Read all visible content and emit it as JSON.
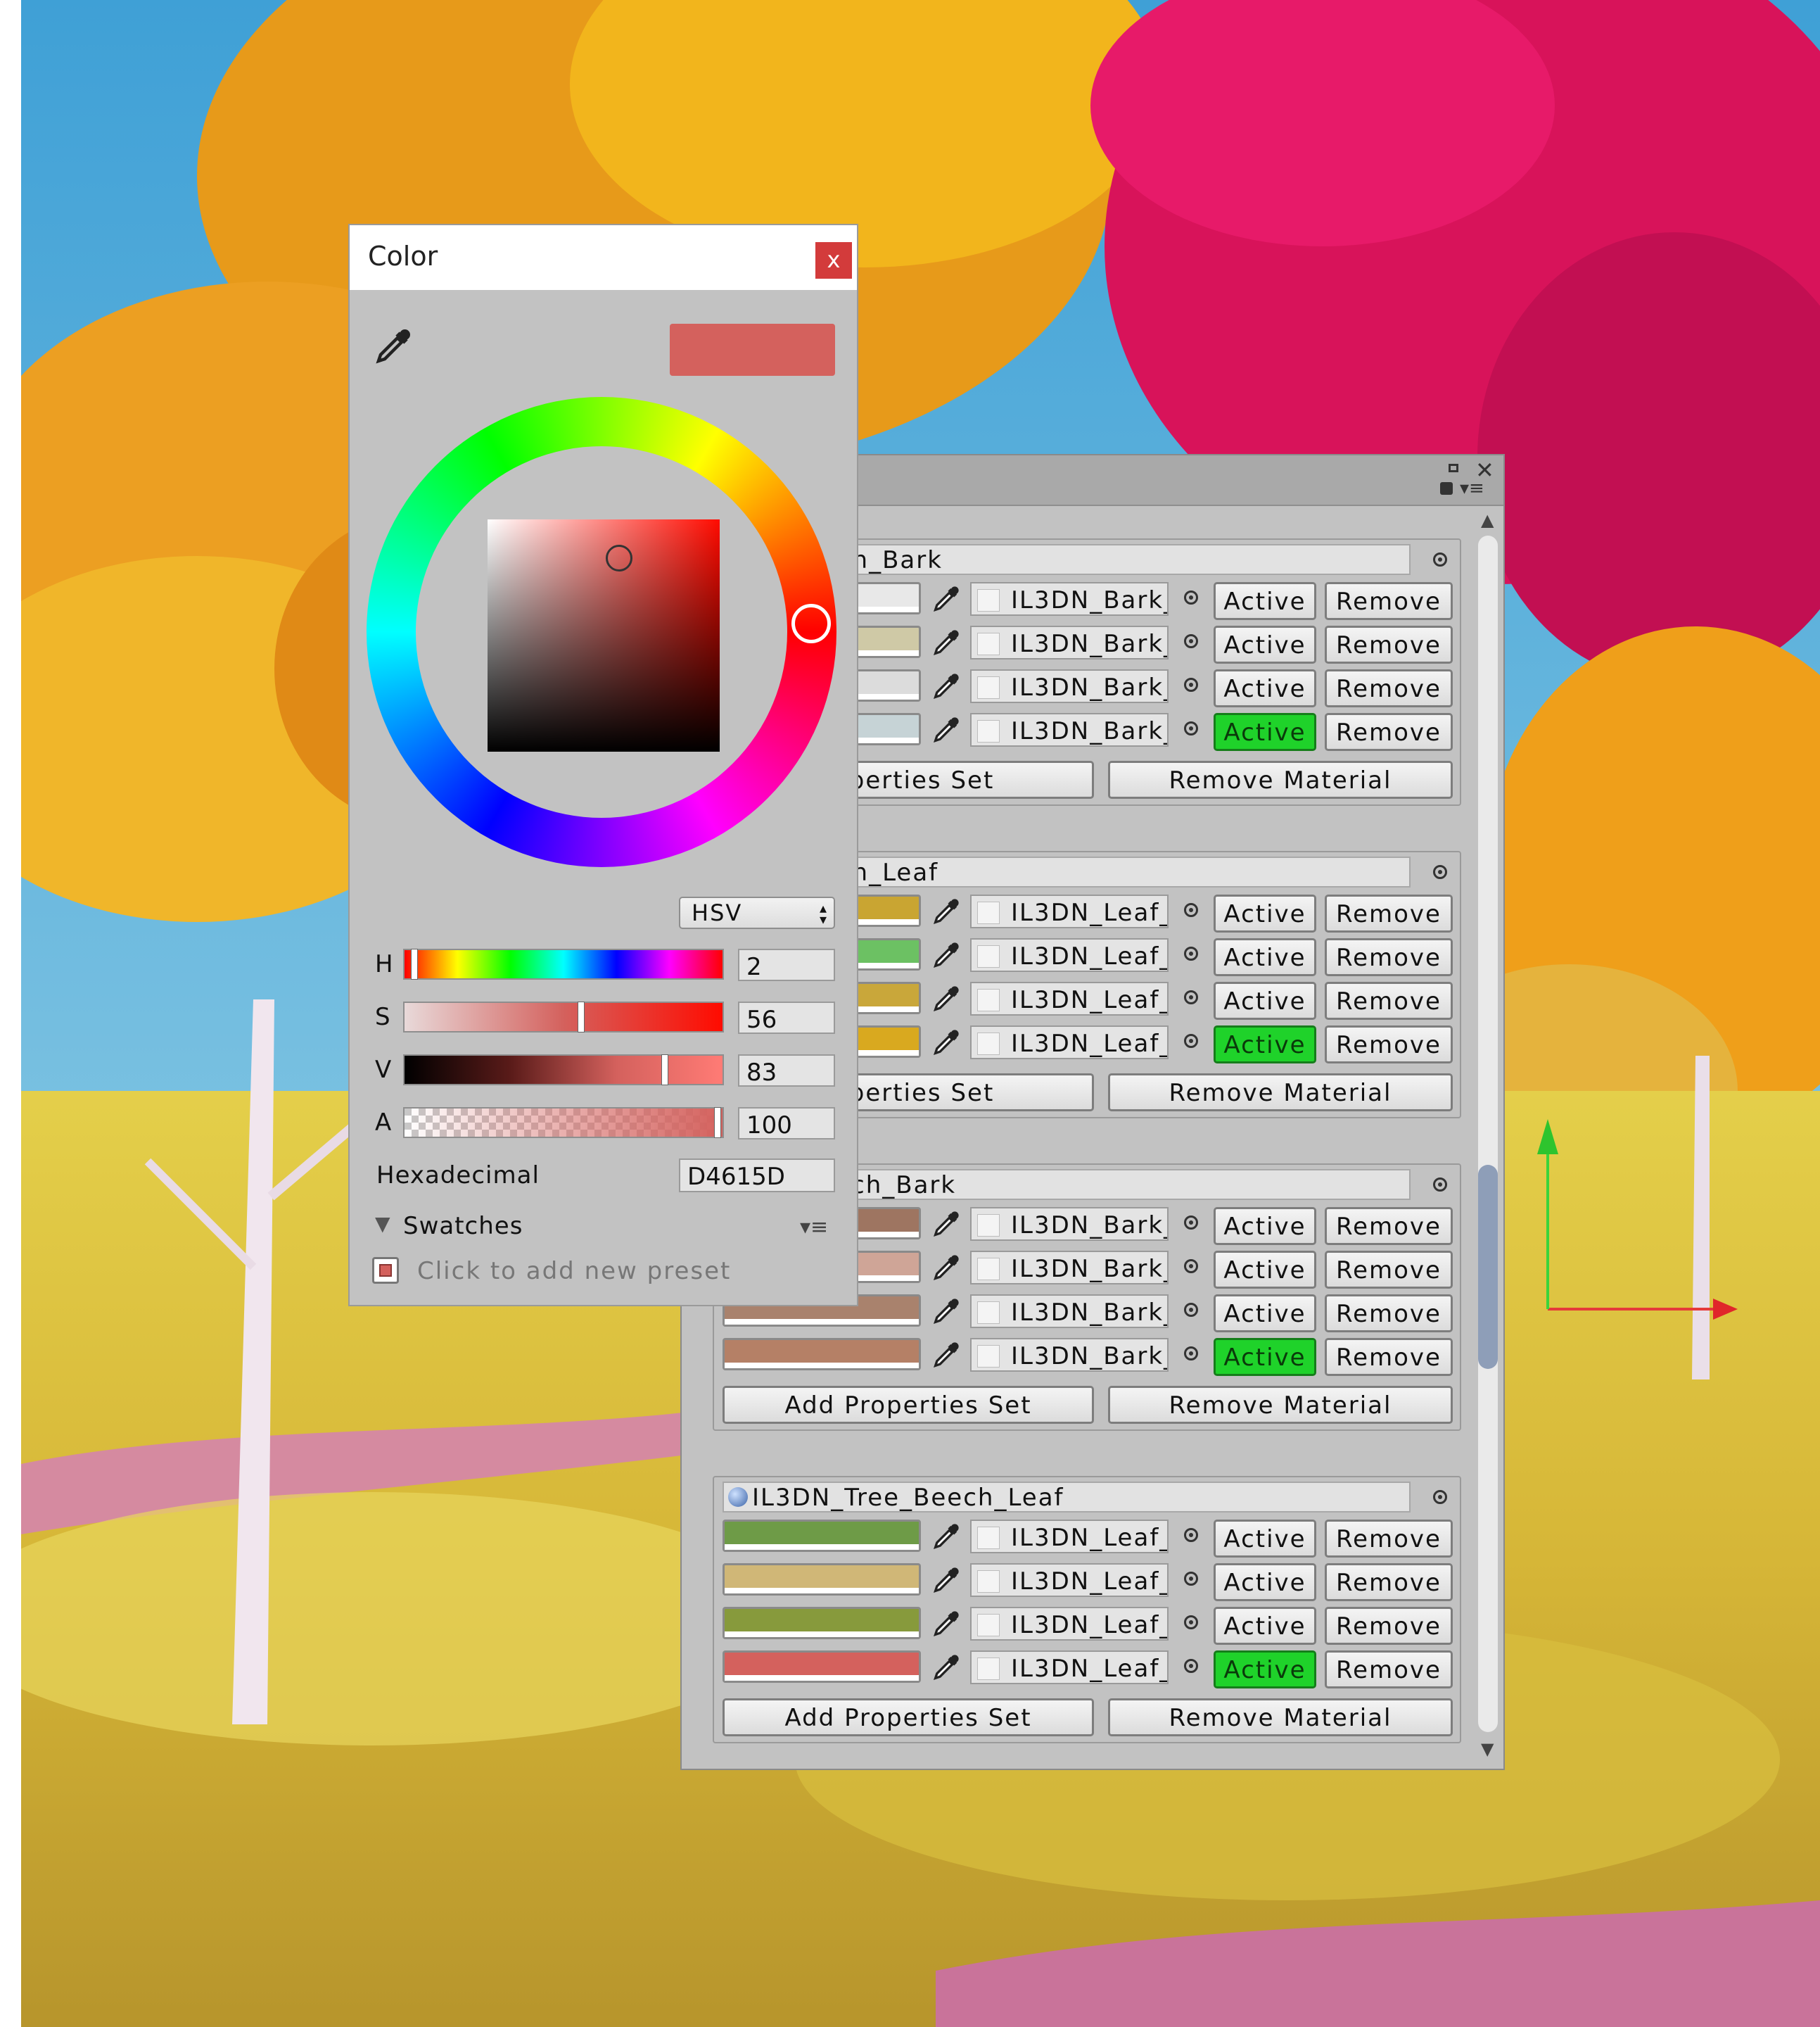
{
  "color_window": {
    "title": "Color",
    "close_label": "x",
    "current_color": "#D4615D",
    "mode": "HSV",
    "sliders": [
      {
        "label": "H",
        "value": "2",
        "position": 0.02
      },
      {
        "label": "S",
        "value": "56",
        "position": 0.56
      },
      {
        "label": "V",
        "value": "83",
        "position": 0.83
      },
      {
        "label": "A",
        "value": "100",
        "position": 1.0
      }
    ],
    "hex_label": "Hexadecimal",
    "hex_value": "D4615D",
    "swatches_label": "Swatches",
    "add_preset_label": "Click to add new preset"
  },
  "inspector": {
    "materials": [
      {
        "name": "Tree_Birch_Bark",
        "rows": [
          {
            "color": "#e8e8e8",
            "material": "IL3DN_Bark_",
            "active": false
          },
          {
            "color": "#cfc9a6",
            "material": "IL3DN_Bark_",
            "active": false
          },
          {
            "color": "#dcdcdc",
            "material": "IL3DN_Bark_",
            "active": false
          },
          {
            "color": "#c6d3d6",
            "material": "IL3DN_Bark_",
            "active": true
          }
        ],
        "add_label": "roperties Set",
        "remove_label": "Remove Material"
      },
      {
        "name": "Tree_Birch_Leaf",
        "rows": [
          {
            "color": "#c9a532",
            "material": "IL3DN_Leaf_",
            "active": false
          },
          {
            "color": "#6cc163",
            "material": "IL3DN_Leaf_",
            "active": false
          },
          {
            "color": "#c9a73a",
            "material": "IL3DN_Leaf_",
            "active": false
          },
          {
            "color": "#d9a91f",
            "material": "IL3DN_Leaf_",
            "active": true
          }
        ],
        "add_label": "roperties Set",
        "remove_label": "Remove Material"
      },
      {
        "name": "Tree_Beech_Bark",
        "rows": [
          {
            "color": "#9e7561",
            "material": "IL3DN_Bark_",
            "active": false
          },
          {
            "color": "#cfa597",
            "material": "IL3DN_Bark_",
            "active": false
          },
          {
            "color": "#a9826d",
            "material": "IL3DN_Bark_",
            "active": false
          },
          {
            "color": "#b58066",
            "material": "IL3DN_Bark_",
            "active": true
          }
        ],
        "add_label": "Add Properties Set",
        "remove_label": "Remove Material"
      },
      {
        "name": "IL3DN_Tree_Beech_Leaf",
        "rows": [
          {
            "color": "#6e9b47",
            "material": "IL3DN_Leaf_",
            "active": false
          },
          {
            "color": "#d0b777",
            "material": "IL3DN_Leaf_",
            "active": false
          },
          {
            "color": "#879a3c",
            "material": "IL3DN_Leaf_",
            "active": false
          },
          {
            "color": "#d4615d",
            "material": "IL3DN_Leaf_",
            "active": true
          }
        ],
        "add_label": "Add Properties Set",
        "remove_label": "Remove Material"
      }
    ],
    "active_label": "Active",
    "remove_label": "Remove"
  }
}
